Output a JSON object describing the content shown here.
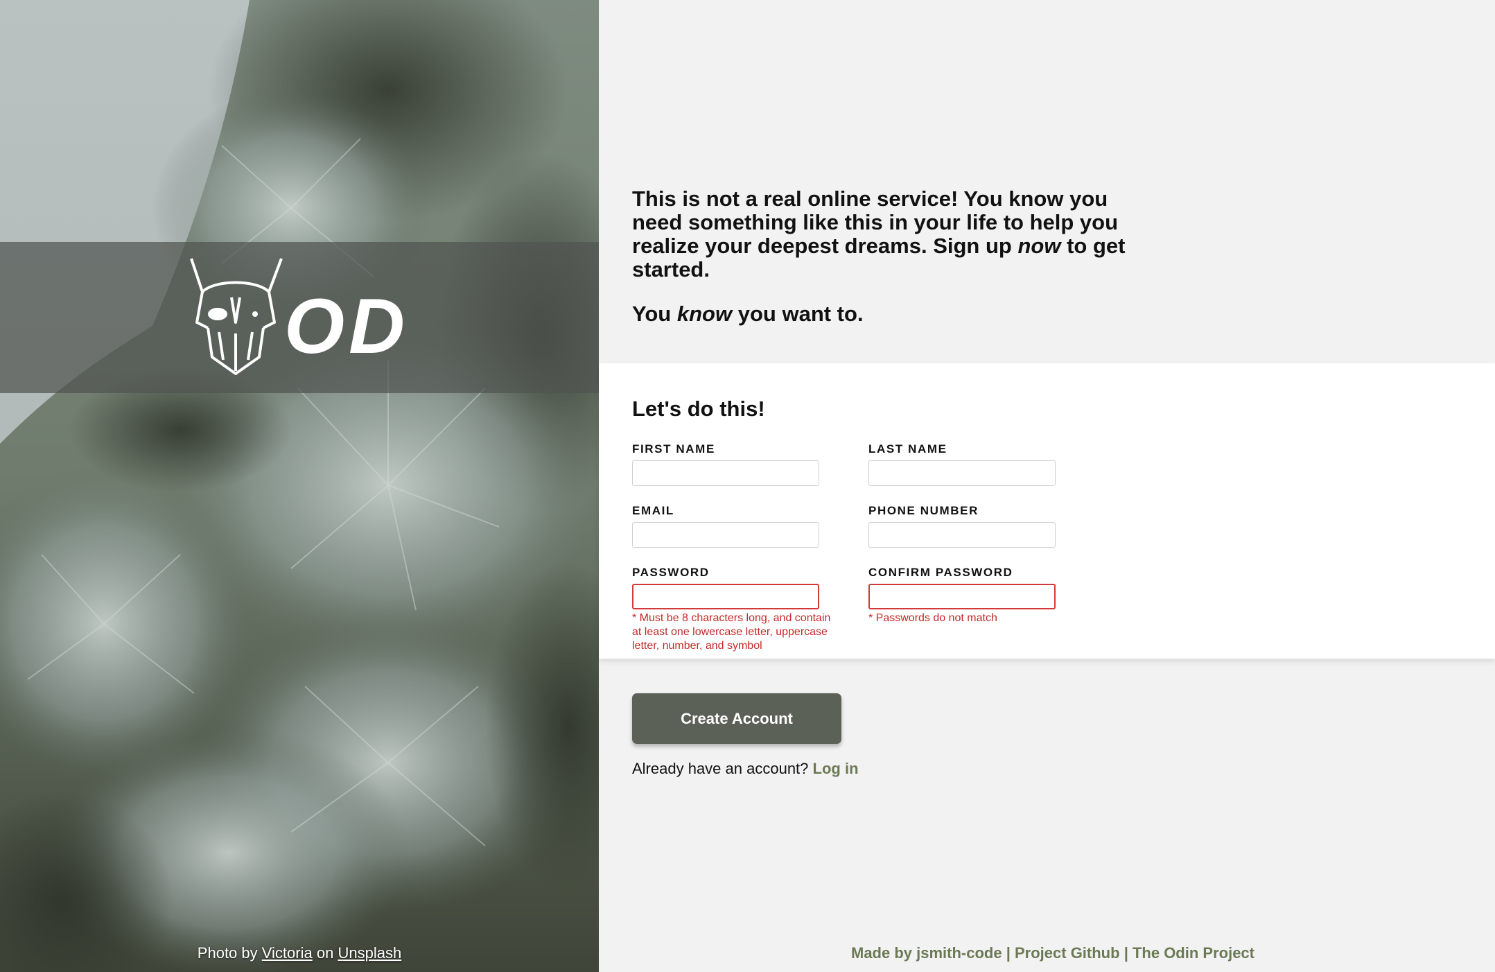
{
  "colors": {
    "accent": "#6b7a55",
    "button": "#5b6157",
    "error": "#c62828",
    "page_bg": "#f2f2f2",
    "card_bg": "#ffffff"
  },
  "brand": {
    "logo_text": "ODIN"
  },
  "photo_credit": {
    "prefix": "Photo by",
    "author": "Victoria",
    "middle": "on",
    "source": "Unsplash"
  },
  "intro": {
    "line1_before": "This is not a real online service! You know you need something like this in your life to help you realize your deepest dreams. Sign up",
    "line1_em": "now",
    "line1_after": "to get started.",
    "line2_before": "You",
    "line2_em": "know",
    "line2_after": "you want to."
  },
  "form": {
    "title": "Let's do this!",
    "fields": {
      "first_name": {
        "label": "FIRST NAME",
        "value": ""
      },
      "last_name": {
        "label": "LAST NAME",
        "value": ""
      },
      "email": {
        "label": "EMAIL",
        "value": ""
      },
      "phone": {
        "label": "PHONE NUMBER",
        "value": ""
      },
      "password": {
        "label": "PASSWORD",
        "value": "",
        "error": "* Must be 8 characters long, and contain at least one lowercase letter, uppercase letter, number, and symbol"
      },
      "confirm_password": {
        "label": "CONFIRM PASSWORD",
        "value": "",
        "error": "* Passwords do not match"
      }
    }
  },
  "actions": {
    "create_account": "Create Account",
    "login_prompt": "Already have an account?",
    "login_link": "Log in"
  },
  "footer": {
    "made_by": "Made by jsmith-code",
    "sep": "|",
    "github": "Project Github",
    "odin": "The Odin Project"
  }
}
